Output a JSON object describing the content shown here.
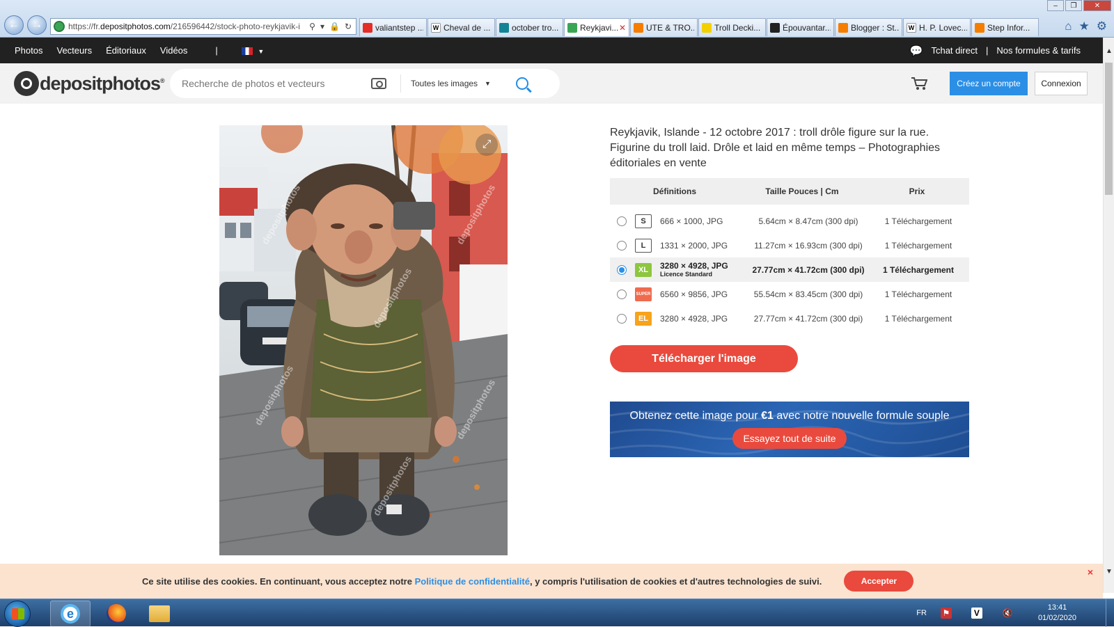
{
  "browser": {
    "url_prefix": "https://fr.",
    "url_domain": "depositphotos.com",
    "url_path": "/216596442/stock-photo-reykjavik-i",
    "tabs": [
      {
        "label": "valiantstep ...",
        "icon": "youtube-icon",
        "color": "#e52d27"
      },
      {
        "label": "Cheval de ...",
        "icon": "wikipedia-icon",
        "color": "#ffffff"
      },
      {
        "label": "october tro...",
        "icon": "bing-icon",
        "color": "#138496"
      },
      {
        "label": "Reykjavi...",
        "icon": "depositphotos-icon",
        "color": "#3aa655",
        "active": true
      },
      {
        "label": "UTE & TRO...",
        "icon": "blogger-icon",
        "color": "#f57d00"
      },
      {
        "label": "Troll Decki...",
        "icon": "troll-face-icon",
        "color": "#f5d000"
      },
      {
        "label": "Épouvantar...",
        "icon": "imdb-icon",
        "color": "#222222"
      },
      {
        "label": "Blogger : St...",
        "icon": "blogger-icon",
        "color": "#f57d00"
      },
      {
        "label": "H. P. Lovec...",
        "icon": "wikipedia-icon",
        "color": "#ffffff"
      },
      {
        "label": "Step Infor...",
        "icon": "blogger-icon",
        "color": "#f57d00"
      }
    ]
  },
  "topbar": {
    "links": [
      "Photos",
      "Vecteurs",
      "Éditoriaux",
      "Vidéos"
    ],
    "separator": "|",
    "chat": "Tchat direct",
    "pricing": "Nos formules & tarifs"
  },
  "header": {
    "logo": "depositphotos",
    "logo_reg": "®",
    "search_placeholder": "Recherche de photos et vecteurs",
    "filter": "Toutes les images",
    "signup": "Créez un compte",
    "login": "Connexion"
  },
  "product": {
    "title": "Reykjavik, Islande - 12 octobre 2017 : troll drôle figure sur la rue. Figurine du troll laid. Drôle et laid en même temps  – Photographies éditoriales en vente",
    "watermark": "depositphotos",
    "columns": [
      "Définitions",
      "Taille Pouces | Cm",
      "Prix"
    ],
    "rows": [
      {
        "badge": "S",
        "res": "666 × 1000, JPG",
        "license": "",
        "size": "5.64cm × 8.47cm (300 dpi)",
        "price": "1 Téléchargement",
        "selected": false
      },
      {
        "badge": "L",
        "res": "1331 × 2000, JPG",
        "license": "",
        "size": "11.27cm × 16.93cm (300 dpi)",
        "price": "1 Téléchargement",
        "selected": false
      },
      {
        "badge": "XL",
        "res": "3280 × 4928, JPG",
        "license": "Licence Standard",
        "size": "27.77cm × 41.72cm (300 dpi)",
        "price": "1 Téléchargement",
        "selected": true
      },
      {
        "badge": "SUPER",
        "res": "6560 × 9856, JPG",
        "license": "",
        "size": "55.54cm × 83.45cm (300 dpi)",
        "price": "1 Téléchargement",
        "selected": false
      },
      {
        "badge": "EL",
        "res": "3280 × 4928, JPG",
        "license": "",
        "size": "27.77cm × 41.72cm (300 dpi)",
        "price": "1 Téléchargement",
        "selected": false
      }
    ],
    "download": "Télécharger l'image",
    "promo_pre": "Obtenez cette image pour ",
    "promo_price": "€1",
    "promo_post": " avec notre nouvelle formule souple",
    "promo_button": "Essayez tout de suite"
  },
  "cookie": {
    "pre": "Ce site utilise des cookies. En continuant, vous acceptez notre ",
    "link": "Politique de confidentialité",
    "post": ", y compris l'utilisation de cookies et d'autres technologies de suivi.",
    "accept": "Accepter",
    "close": "×"
  },
  "taskbar": {
    "lang": "FR",
    "time": "13:41",
    "date": "01/02/2020"
  },
  "colors": {
    "accent_blue": "#2b8fe6",
    "accent_red": "#e94a3d",
    "topbar_bg": "#212121"
  }
}
